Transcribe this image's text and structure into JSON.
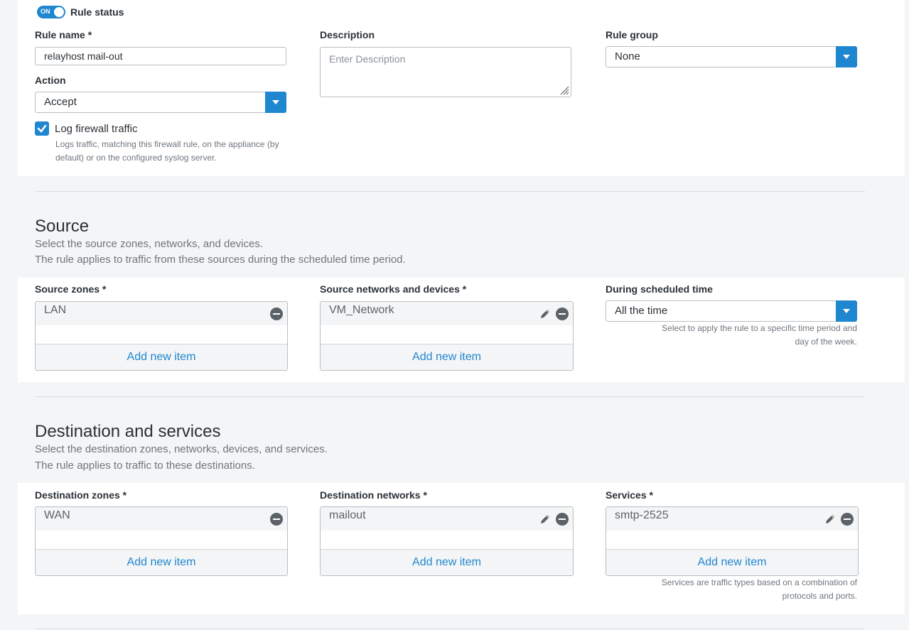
{
  "rule_status": {
    "toggle_state": "ON",
    "label": "Rule status"
  },
  "rule_name": {
    "label": "Rule name *",
    "value": "relayhost mail-out"
  },
  "description": {
    "label": "Description",
    "placeholder": "Enter Description"
  },
  "rule_group": {
    "label": "Rule group",
    "value": "None"
  },
  "action": {
    "label": "Action",
    "value": "Accept"
  },
  "log": {
    "label": "Log firewall traffic",
    "help_line1": "Logs traffic, matching this firewall rule, on the appliance (by",
    "help_line2": "default) or on the configured syslog server."
  },
  "source": {
    "title": "Source",
    "desc1": "Select the source zones, networks, and devices.",
    "desc2": "The rule applies to traffic from these sources during the scheduled time period.",
    "zones": {
      "label": "Source zones *",
      "items": [
        "LAN"
      ],
      "add": "Add new item"
    },
    "networks": {
      "label": "Source networks and devices *",
      "items": [
        "VM_Network"
      ],
      "add": "Add new item"
    },
    "schedule": {
      "label": "During scheduled time",
      "value": "All the time",
      "help_line1": "Select to apply the rule to a specific time period and",
      "help_line2": "day of the week."
    }
  },
  "destination": {
    "title": "Destination and services",
    "desc1": "Select the destination zones, networks, devices, and services.",
    "desc2": "The rule applies to traffic to these destinations.",
    "zones": {
      "label": "Destination zones *",
      "items": [
        "WAN"
      ],
      "add": "Add new item"
    },
    "networks": {
      "label": "Destination networks *",
      "items": [
        "mailout"
      ],
      "add": "Add new item"
    },
    "services": {
      "label": "Services *",
      "items": [
        "smtp-2525"
      ],
      "add": "Add new item",
      "help_line1": "Services are traffic types based on a combination of",
      "help_line2": "protocols and ports."
    }
  },
  "colors": {
    "accent": "#1f86d0",
    "panel": "#ffffff",
    "background": "#f4f5f6"
  }
}
